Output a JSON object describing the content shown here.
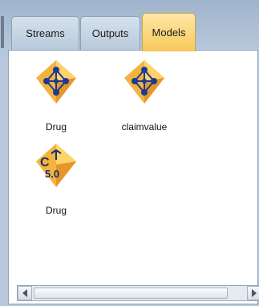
{
  "tabs": [
    {
      "label": "Streams"
    },
    {
      "label": "Outputs"
    },
    {
      "label": "Models"
    }
  ],
  "active_tab": "Models",
  "models": [
    {
      "label": "Drug",
      "icon": "neural-net-model-icon"
    },
    {
      "label": "claimvalue",
      "icon": "neural-net-model-icon"
    },
    {
      "label": "Drug",
      "icon": "c50-model-icon",
      "icon_text": "5.0"
    }
  ],
  "colors": {
    "active_tab": "#f6c85a",
    "model_gem": "#f3b43f",
    "node_blue": "#1c3a96"
  }
}
